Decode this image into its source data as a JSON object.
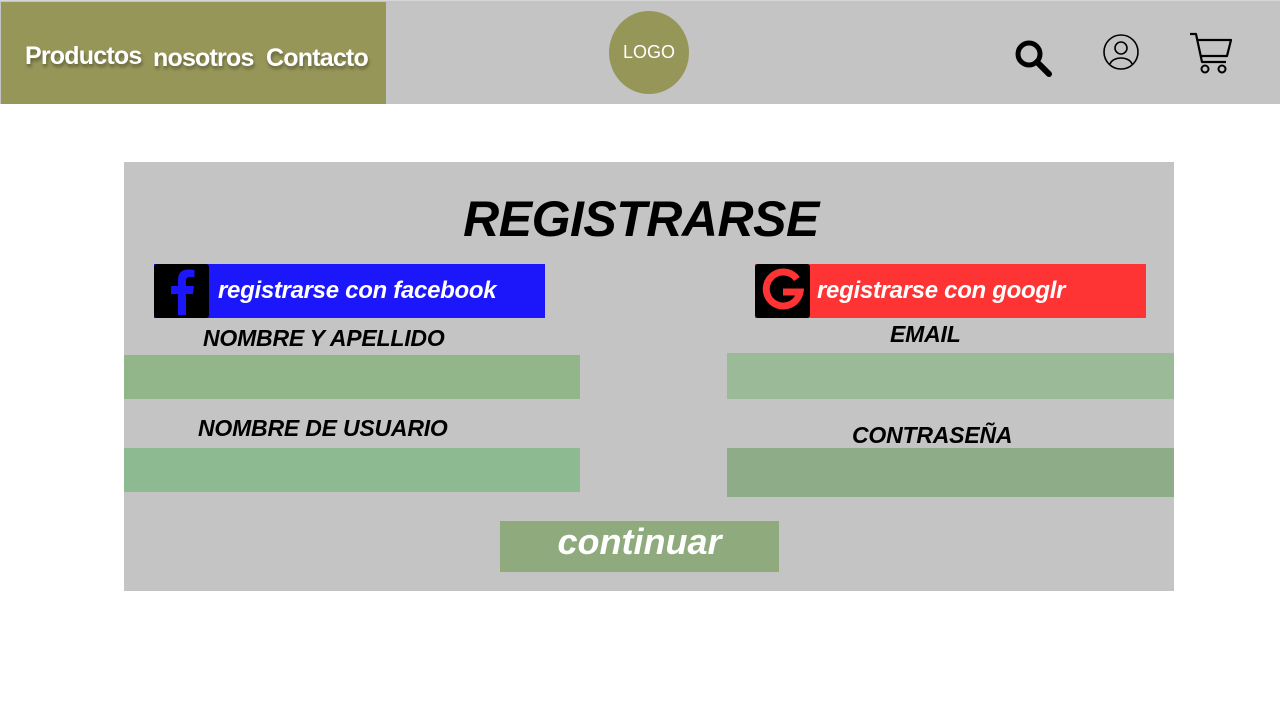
{
  "header": {
    "nav": [
      "Productos",
      "nosotros",
      "Contacto"
    ],
    "logo": "LOGO",
    "icons": [
      "search-icon",
      "user-icon",
      "cart-icon"
    ]
  },
  "form": {
    "title": "REGISTRARSE",
    "facebook_label": "registrarse con facebook",
    "google_label": "registrarse con googlr",
    "labels": {
      "name": "NOMBRE Y APELLIDO",
      "email": "EMAIL",
      "username": "NOMBRE DE USUARIO",
      "password": "CONTRASEÑA"
    },
    "values": {
      "name": "",
      "email": "",
      "username": "",
      "password": ""
    },
    "continue_label": "continuar"
  },
  "colors": {
    "nav_bg": "#979659",
    "header_bg": "#c4c4c4",
    "panel_bg": "#c4c4c4",
    "facebook": "#1c16fb",
    "google": "#fe3333",
    "field_name": "#92b589",
    "field_email": "#9bba97",
    "field_username": "#8eba91",
    "field_password": "#8fac89",
    "continue": "#8faa7c"
  }
}
